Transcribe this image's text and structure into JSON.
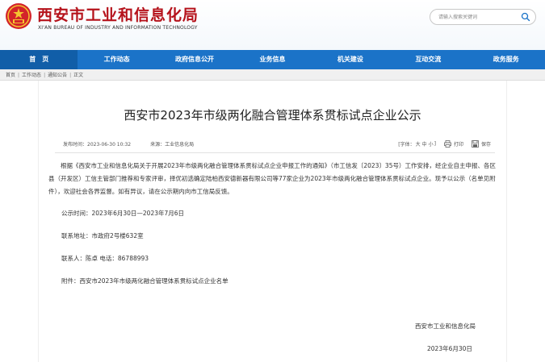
{
  "header": {
    "title": "西安市工业和信息化局",
    "subtitle": "XI'AN BUREAU OF INDUSTRY AND INFORMATION TECHNOLOGY",
    "search_placeholder": "请输入搜索关键词"
  },
  "nav": {
    "items": [
      {
        "label": "首　页"
      },
      {
        "label": "工作动态"
      },
      {
        "label": "政府信息公开"
      },
      {
        "label": "业务信息"
      },
      {
        "label": "机关建设"
      },
      {
        "label": "互动交流"
      },
      {
        "label": "政务服务"
      }
    ]
  },
  "breadcrumb": {
    "items": [
      "首页",
      "工作动态",
      "通知公告",
      "正文"
    ]
  },
  "article": {
    "title": "西安市2023年市级两化融合管理体系贯标试点企业公示",
    "publish_time_label": "发布时间：",
    "publish_time": "2023-06-30 10:32",
    "source_label": "来源：",
    "source": "工业信息化局",
    "font_label": "[字体：",
    "font_large": "大",
    "font_medium": "中",
    "font_small": "小",
    "font_close": "]",
    "print_label": "打印",
    "save_label": "保存",
    "body_text": "根据《西安市工业和信息化局关于开展2023年市级两化融合管理体系贯标试点企业申报工作的通知》（市工信发〔2023〕35号）工作安排，经企业自主申报、各区县（开发区）工信主管部门推荐和专家评审，择优初选确定陆柏西安德新器有限公司等77家企业为2023年市级两化融合管理体系贯标试点企业。现予以公示（名单见附件），欢迎社会各界监督。如有异议，请在公示期内向市工信局反馈。",
    "notice_period": "公示时间：2023年6月30日—2023年7月6日",
    "contact_address": "联系地址：市政府2号楼632室",
    "contact_person": "联系人：陈卓  电话：86788993",
    "attachment": "附件：西安市2023年市级两化融合管理体系贯标试点企业名单",
    "sign_org": "西安市工业和信息化局",
    "sign_date": "2023年6月30日"
  },
  "colors": {
    "brand_red": "#b5121b",
    "nav_blue": "#1b73c8"
  },
  "icons": [
    "emblem-icon",
    "search-icon",
    "print-icon",
    "save-icon"
  ]
}
